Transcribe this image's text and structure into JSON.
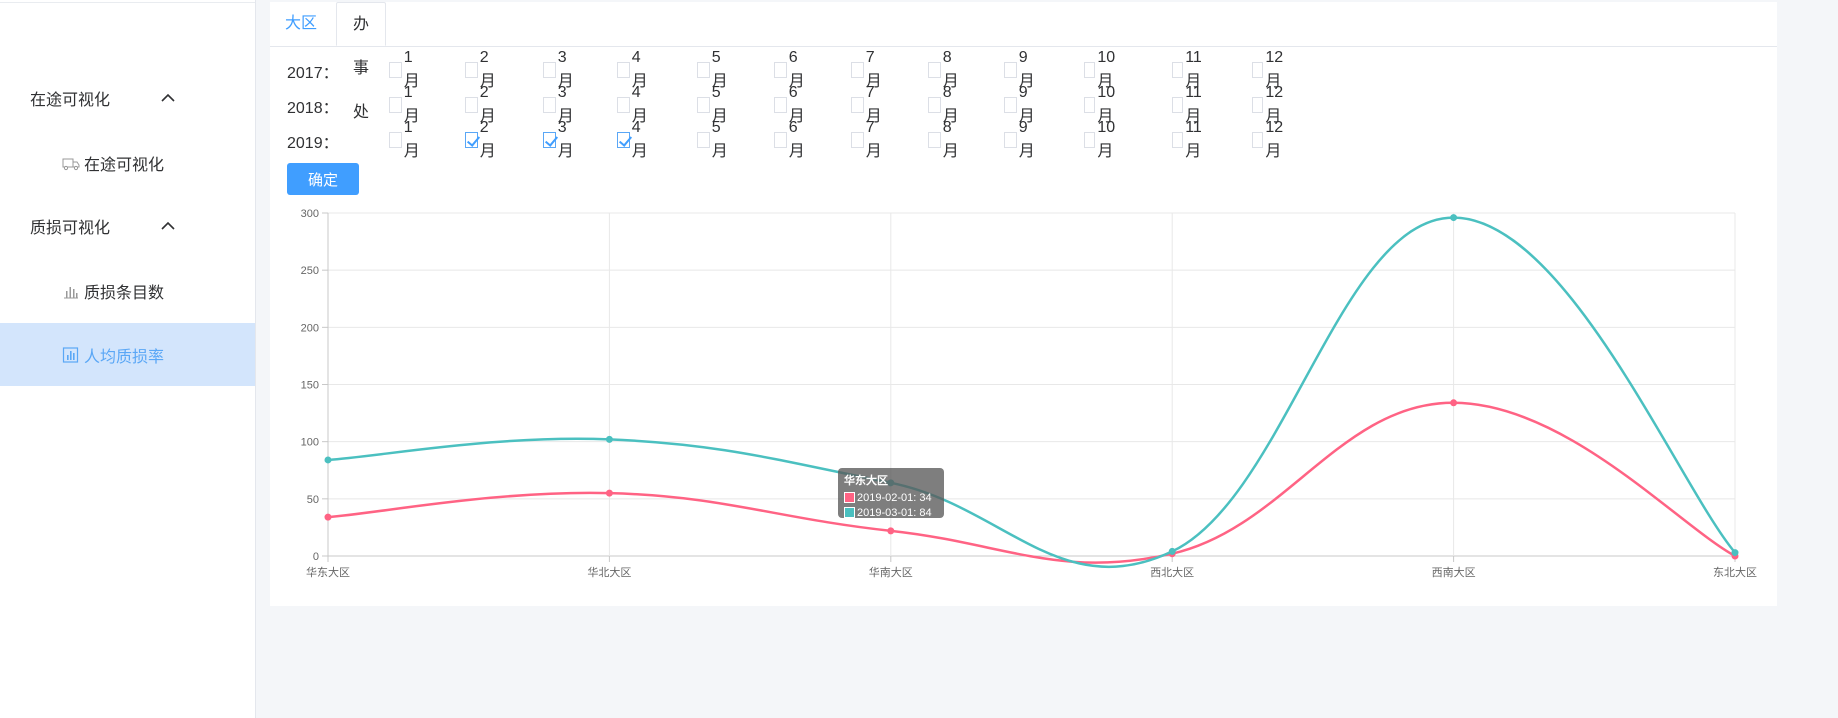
{
  "sidebar": {
    "groups": [
      {
        "label": "在途可视化",
        "items": [
          {
            "label": "在途可视化",
            "icon": "truck-icon"
          }
        ]
      },
      {
        "label": "质损可视化",
        "items": [
          {
            "label": "质损条目数",
            "icon": "bar-chart-icon"
          },
          {
            "label": "人均质损率",
            "icon": "chart-box-icon",
            "active": true
          }
        ]
      }
    ]
  },
  "tabs": [
    {
      "label": "大区",
      "active": true
    },
    {
      "label": "办事处",
      "active": false
    }
  ],
  "years": [
    {
      "label": "2017：",
      "checked": []
    },
    {
      "label": "2018：",
      "checked": []
    },
    {
      "label": "2019：",
      "checked": [
        "2月",
        "3月",
        "4月"
      ]
    }
  ],
  "months": [
    "1月",
    "2月",
    "3月",
    "4月",
    "5月",
    "6月",
    "7月",
    "8月",
    "9月",
    "10月",
    "11月",
    "12月"
  ],
  "confirm_label": "确定",
  "colors": {
    "accent": "#409eff",
    "series_pink": "#ff6384",
    "series_teal": "#4bc0c0"
  },
  "chart_data": {
    "type": "line",
    "categories": [
      "华东大区",
      "华北大区",
      "华南大区",
      "西北大区",
      "西南大区",
      "东北大区"
    ],
    "ylim": [
      0,
      300
    ],
    "yticks": [
      0,
      50,
      100,
      150,
      200,
      250,
      300
    ],
    "grid": true,
    "series": [
      {
        "name": "2019-02-01",
        "color": "#ff6384",
        "values": [
          34,
          55,
          22,
          2,
          134,
          0
        ]
      },
      {
        "name": "2019-03-01",
        "color": "#4bc0c0",
        "values": [
          84,
          102,
          64,
          4,
          296,
          3
        ]
      }
    ],
    "tooltip": {
      "title": "华东大区",
      "rows": [
        "2019-02-01: 34",
        "2019-03-01: 84"
      ]
    }
  }
}
